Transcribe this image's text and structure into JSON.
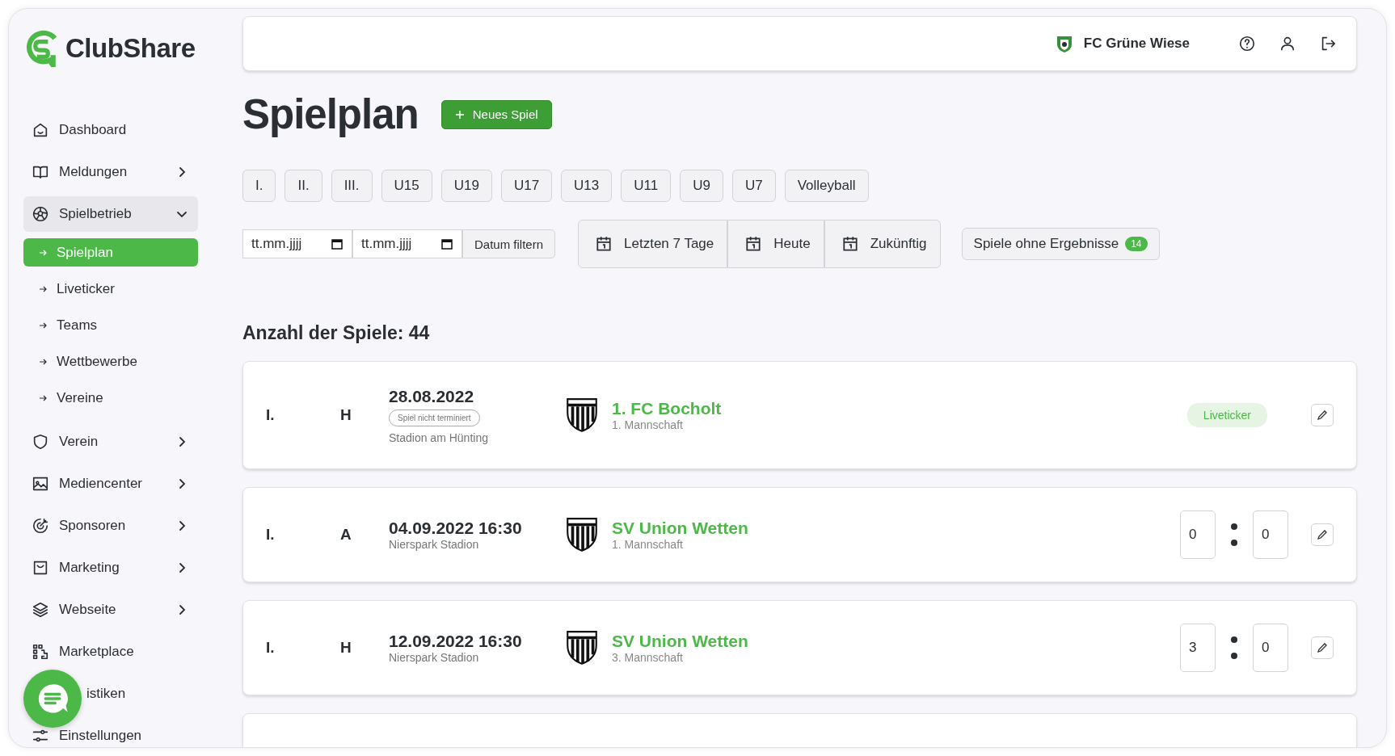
{
  "brand": {
    "name": "ClubShare"
  },
  "sidebar": {
    "items": [
      {
        "label": "Dashboard",
        "kind": "link"
      },
      {
        "label": "Meldungen",
        "kind": "group",
        "expanded": false
      },
      {
        "label": "Spielbetrieb",
        "kind": "group",
        "expanded": true,
        "children": [
          {
            "label": "Spielplan",
            "selected": true
          },
          {
            "label": "Liveticker",
            "selected": false
          },
          {
            "label": "Teams",
            "selected": false
          },
          {
            "label": "Wettbewerbe",
            "selected": false
          },
          {
            "label": "Vereine",
            "selected": false
          }
        ]
      },
      {
        "label": "Verein",
        "kind": "group",
        "expanded": false
      },
      {
        "label": "Mediencenter",
        "kind": "group",
        "expanded": false
      },
      {
        "label": "Sponsoren",
        "kind": "group",
        "expanded": false
      },
      {
        "label": "Marketing",
        "kind": "group",
        "expanded": false
      },
      {
        "label": "Webseite",
        "kind": "group",
        "expanded": false
      },
      {
        "label": "Marketplace",
        "kind": "link"
      },
      {
        "label": "istiken",
        "kind": "link"
      },
      {
        "label": "Einstellungen",
        "kind": "link"
      }
    ]
  },
  "header": {
    "club": "FC Grüne Wiese"
  },
  "page": {
    "title": "Spielplan",
    "new_button": "Neues Spiel"
  },
  "team_filters": [
    {
      "label": "I."
    },
    {
      "label": "II."
    },
    {
      "label": "III."
    },
    {
      "label": "U15"
    },
    {
      "label": "U19"
    },
    {
      "label": "U17"
    },
    {
      "label": "U13"
    },
    {
      "label": "U11"
    },
    {
      "label": "U9"
    },
    {
      "label": "U7"
    },
    {
      "label": "Volleyball"
    }
  ],
  "date_filter": {
    "from_placeholder": "tt.mm.jjjj",
    "to_placeholder": "tt.mm.jjjj",
    "button": "Datum filtern"
  },
  "quick_filters": [
    {
      "label": "Letzten 7 Tage"
    },
    {
      "label": "Heute"
    },
    {
      "label": "Zukünftig"
    }
  ],
  "no_results_filter": {
    "label": "Spiele ohne Ergebnisse",
    "count": "14"
  },
  "count_label": "Anzahl der Spiele: 44",
  "matches": [
    {
      "team": "I.",
      "side": "H",
      "date": "28.08.2022",
      "badge": "Spiel nicht terminiert",
      "venue": "Stadion am Hünting",
      "opponent": "1. FC Bocholt",
      "squad": "1. Mannschaft",
      "kind": "liveticker",
      "action": "Liveticker"
    },
    {
      "team": "I.",
      "side": "A",
      "date": "04.09.2022 16:30",
      "venue": "Nierspark Stadion",
      "opponent": "SV Union Wetten",
      "squad": "1. Mannschaft",
      "kind": "score",
      "home": "0",
      "away": "0"
    },
    {
      "team": "I.",
      "side": "H",
      "date": "12.09.2022 16:30",
      "venue": "Nierspark Stadion",
      "opponent": "SV Union Wetten",
      "squad": "3. Mannschaft",
      "kind": "score",
      "home": "3",
      "away": "0"
    }
  ]
}
